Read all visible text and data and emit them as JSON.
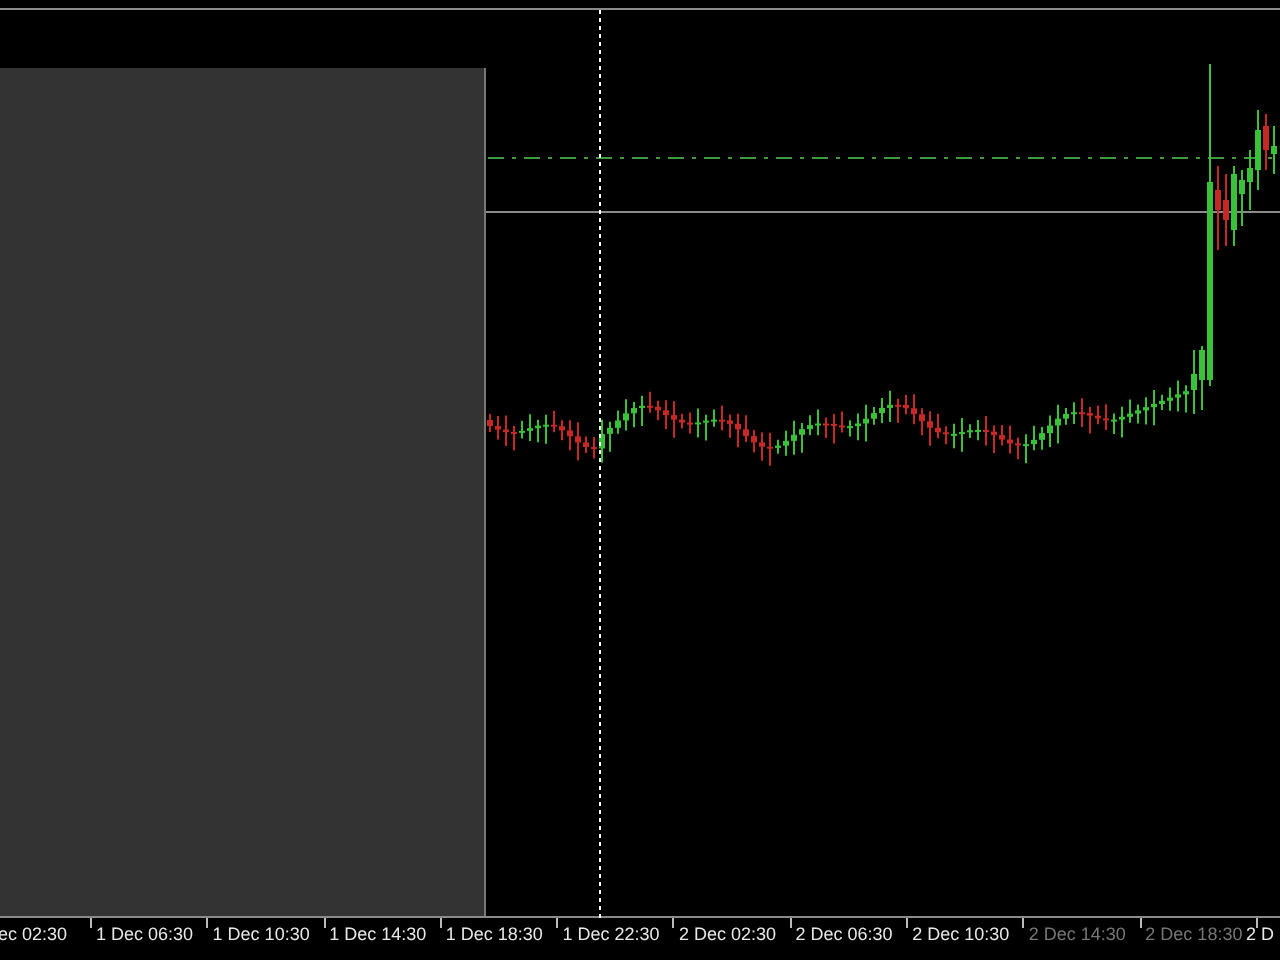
{
  "time_axis": {
    "labels": [
      {
        "text": "ec 02:30",
        "dimmed": false
      },
      {
        "text": "1 Dec 06:30",
        "dimmed": false
      },
      {
        "text": "1 Dec 10:30",
        "dimmed": false
      },
      {
        "text": "1 Dec 14:30",
        "dimmed": false
      },
      {
        "text": "1 Dec 18:30",
        "dimmed": false
      },
      {
        "text": "1 Dec 22:30",
        "dimmed": false
      },
      {
        "text": "2 Dec 02:30",
        "dimmed": false
      },
      {
        "text": "2 Dec 06:30",
        "dimmed": false
      },
      {
        "text": "2 Dec 10:30",
        "dimmed": false
      },
      {
        "text": "2 Dec 14:30",
        "dimmed": true
      },
      {
        "text": "2 Dec 18:30",
        "dimmed": true
      },
      {
        "text": "2 D",
        "dimmed": false
      }
    ]
  }
}
